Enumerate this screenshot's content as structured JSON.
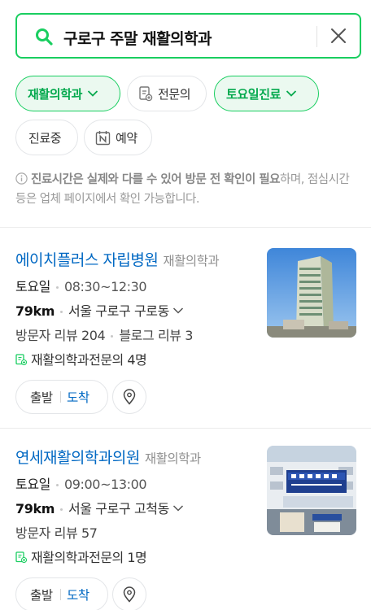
{
  "search": {
    "query": "구로구 주말 재활의학과"
  },
  "filters": {
    "chips": [
      {
        "label": "재활의학과",
        "icon": "chevron-down-icon",
        "active": true
      },
      {
        "label": "전문의",
        "icon": "document-plus-icon",
        "active": false
      },
      {
        "label": "토요일진료",
        "icon": "chevron-down-icon",
        "active": true
      },
      {
        "label": "진료중",
        "icon": "",
        "active": false
      },
      {
        "label": "예약",
        "icon": "naver-booking-icon",
        "active": false
      }
    ]
  },
  "notice": {
    "bold": "진료시간은 실제와 다를 수 있어 방문 전 확인이 필요",
    "rest": "하며, 점심시간 등은 업체 페이지에서 확인 가능합니다."
  },
  "results": [
    {
      "name": "에이치플러스 자립병원",
      "category": "재활의학과",
      "day": "토요일",
      "hours": "08:30~12:30",
      "distance": "79km",
      "address": "서울 구로구 구로동",
      "visitor_reviews": "방문자 리뷰 204",
      "blog_reviews": "블로그 리뷰 3",
      "specialist": "재활의학과전문의 4명",
      "route_depart": "출발",
      "route_arrive": "도착"
    },
    {
      "name": "연세재활의학과의원",
      "category": "재활의학과",
      "day": "토요일",
      "hours": "09:00~13:00",
      "distance": "79km",
      "address": "서울 구로구 고척동",
      "visitor_reviews": "방문자 리뷰 57",
      "blog_reviews": "",
      "specialist": "재활의학과전문의 1명",
      "route_depart": "출발",
      "route_arrive": "도착"
    }
  ],
  "colors": {
    "accent": "#19ce60",
    "link": "#0068c3"
  }
}
